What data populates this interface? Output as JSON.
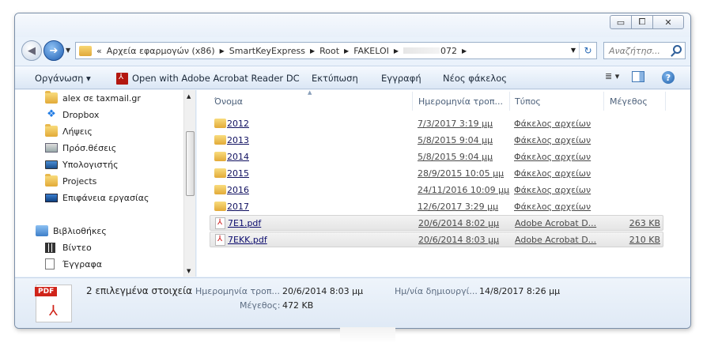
{
  "window": {
    "controls": {
      "minimize": "▭",
      "maximize": "⧠",
      "close": "✕"
    }
  },
  "address": {
    "crumbs_prefix": "«",
    "crumbs": [
      "Αρχεία εφαρμογών (x86)",
      "SmartKeyExpress",
      "Root",
      "FAKELOI"
    ],
    "blurred_tail": "072",
    "search_placeholder": "Αναζήτησ..."
  },
  "toolbar": {
    "organize": "Οργάνωση ▾",
    "open_with": "Open with Adobe Acrobat Reader DC",
    "print": "Εκτύπωση",
    "burn": "Εγγραφή",
    "new_folder": "Νέος φάκελος",
    "views_icon": "≣ ▾",
    "help": "?"
  },
  "nav": {
    "items": [
      {
        "label": "alex σε taxmail.gr",
        "icon": "folder-icon"
      },
      {
        "label": "Dropbox",
        "icon": "dropbox-icon"
      },
      {
        "label": "Λήψεις",
        "icon": "downloads-icon"
      },
      {
        "label": "Πρόσ.θέσεις",
        "icon": "recent-places-icon"
      },
      {
        "label": "Υπολογιστής",
        "icon": "computer-icon"
      },
      {
        "label": "Projects",
        "icon": "folder-icon"
      },
      {
        "label": "Επιφάνεια εργασίας",
        "icon": "desktop-icon"
      },
      {
        "label": "Βιβλιοθήκες",
        "icon": "libraries-icon"
      },
      {
        "label": "Βίντεο",
        "icon": "videos-icon"
      },
      {
        "label": "Έγγραφα",
        "icon": "documents-icon"
      }
    ]
  },
  "columns": {
    "name": "Όνομα",
    "date": "Ημερομηνία τροπ...",
    "type": "Τύπος",
    "size": "Μέγεθος"
  },
  "files": [
    {
      "name": "2012",
      "date": "7/3/2017 3:19 μμ",
      "type": "Φάκελος αρχείων",
      "size": "",
      "kind": "folder",
      "selected": false
    },
    {
      "name": "2013",
      "date": "5/8/2015 9:04 μμ",
      "type": "Φάκελος αρχείων",
      "size": "",
      "kind": "folder",
      "selected": false
    },
    {
      "name": "2014",
      "date": "5/8/2015 9:04 μμ",
      "type": "Φάκελος αρχείων",
      "size": "",
      "kind": "folder",
      "selected": false
    },
    {
      "name": "2015",
      "date": "28/9/2015 10:05 μμ",
      "type": "Φάκελος αρχείων",
      "size": "",
      "kind": "folder",
      "selected": false
    },
    {
      "name": "2016",
      "date": "24/11/2016 10:09 μμ",
      "type": "Φάκελος αρχείων",
      "size": "",
      "kind": "folder",
      "selected": false
    },
    {
      "name": "2017",
      "date": "12/6/2017 3:29 μμ",
      "type": "Φάκελος αρχείων",
      "size": "",
      "kind": "folder",
      "selected": false
    },
    {
      "name": "7E1.pdf",
      "date": "20/6/2014 8:02 μμ",
      "type": "Adobe Acrobat D...",
      "size": "263 KB",
      "kind": "pdf",
      "selected": true
    },
    {
      "name": "7EKK.pdf",
      "date": "20/6/2014 8:03 μμ",
      "type": "Adobe Acrobat D...",
      "size": "210 KB",
      "kind": "pdf",
      "selected": true
    }
  ],
  "details": {
    "badge": "PDF",
    "selection": "2 επιλεγμένα στοιχεία",
    "modified_label": "Ημερομηνία τροπ...",
    "modified_value": "20/6/2014 8:03 μμ",
    "size_label": "Μέγεθος:",
    "size_value": "472 KB",
    "created_label": "Ημ/νία δημιουργί...",
    "created_value": "14/8/2017 8:26 μμ"
  },
  "colors": {
    "window_bg": "#eaf2fb",
    "accent": "#1f5fb3",
    "selection_bg": "#e8e8e8",
    "pdf_red": "#d0241a"
  }
}
